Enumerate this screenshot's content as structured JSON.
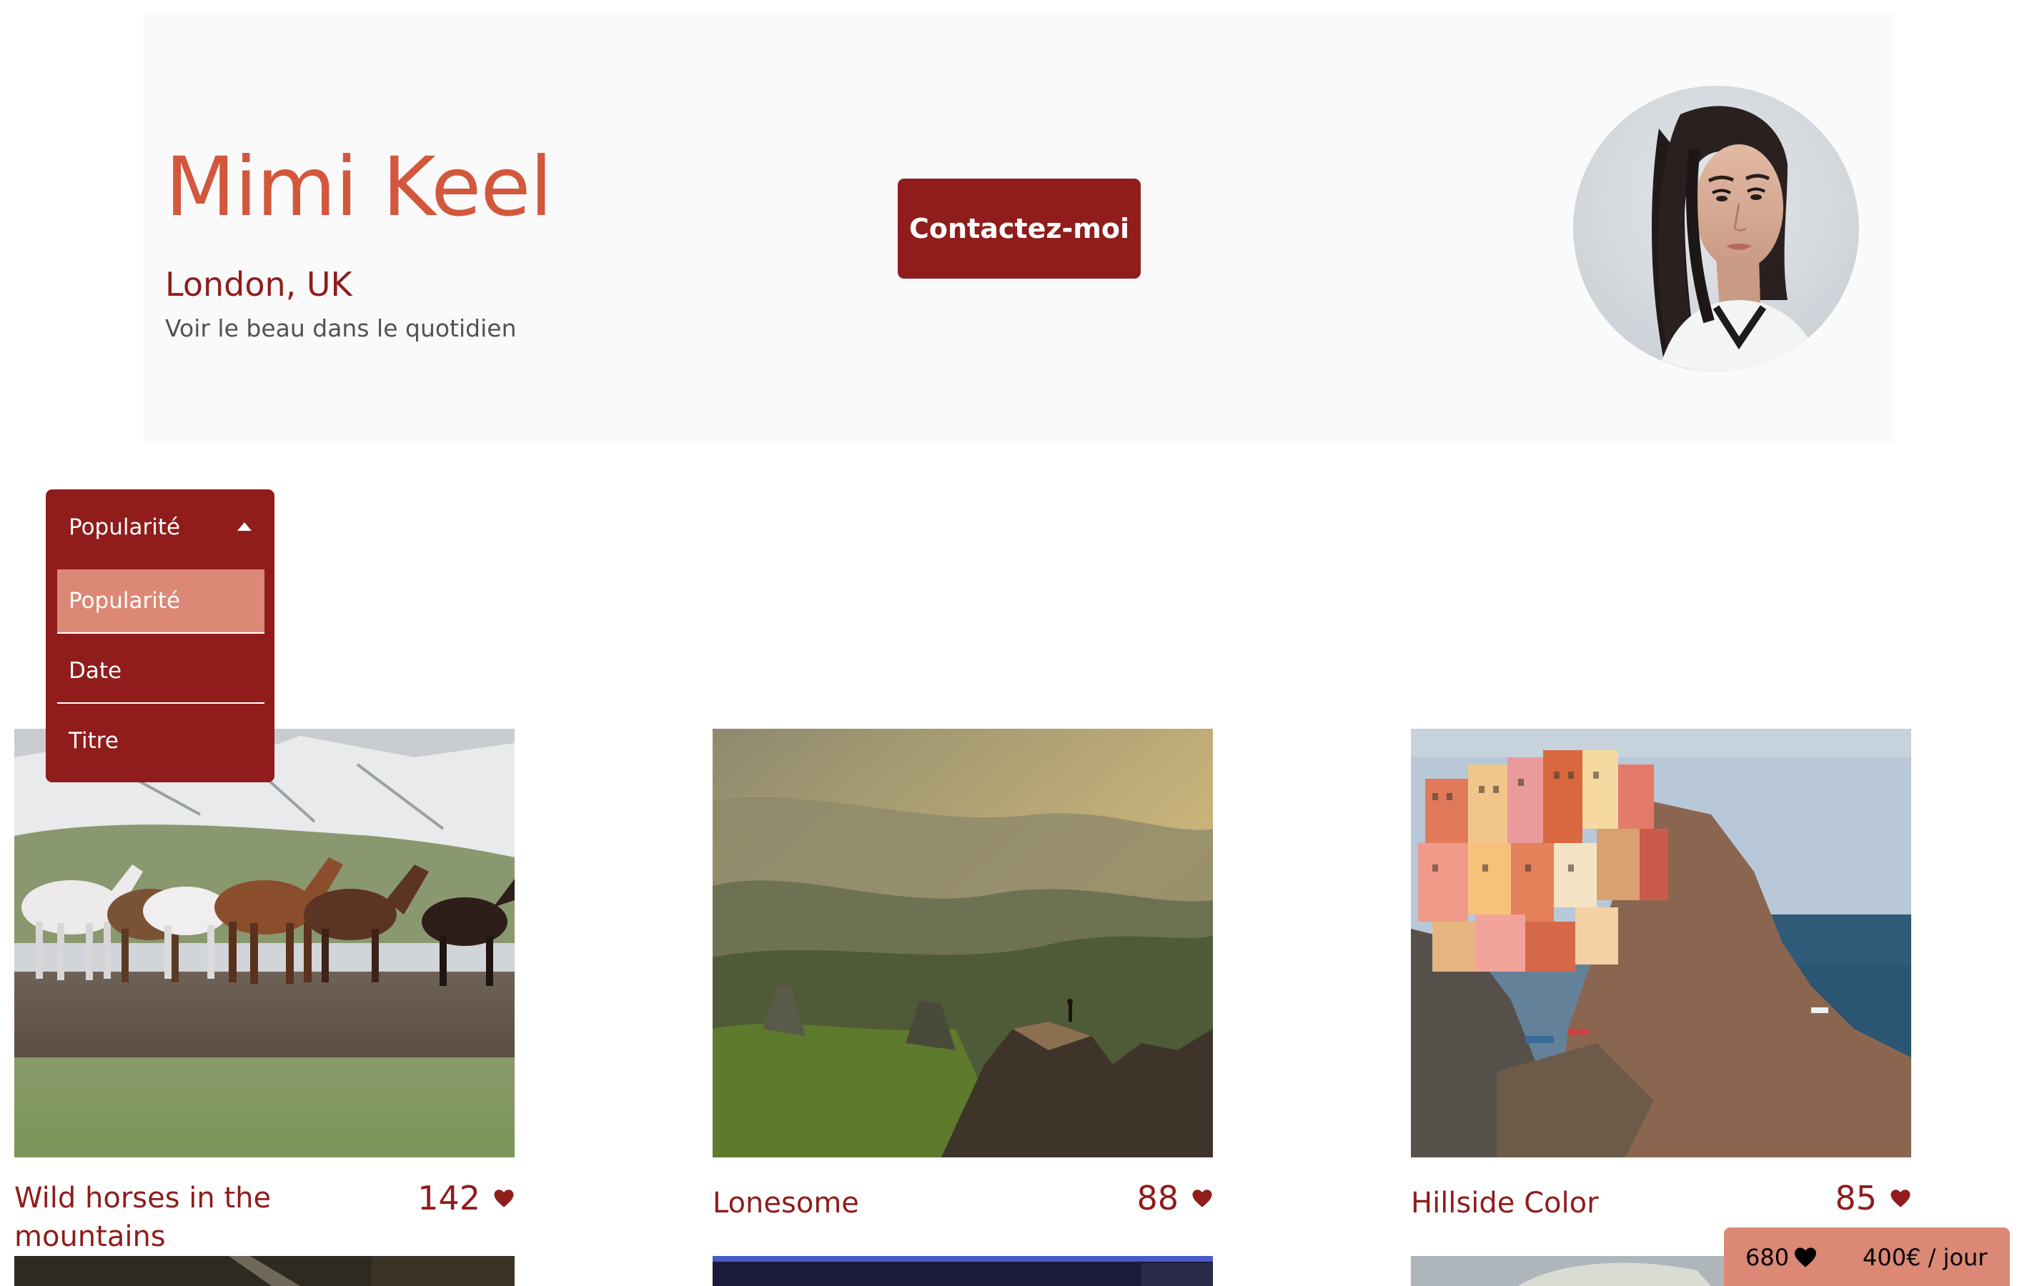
{
  "header": {
    "name": "Mimi Keel",
    "location": "London, UK",
    "tagline": "Voir le beau dans le quotidien",
    "contact_label": "Contactez-moi"
  },
  "sort": {
    "selected": "Popularité",
    "options": [
      "Popularité",
      "Date",
      "Titre"
    ],
    "active_index": 0
  },
  "media": [
    {
      "title": "Wild horses in the mountains",
      "likes": "142"
    },
    {
      "title": "Lonesome",
      "likes": "88"
    },
    {
      "title": "Hillside Color",
      "likes": "85"
    }
  ],
  "stats": {
    "total_likes": "680",
    "price": "400€ / jour"
  },
  "colors": {
    "primary": "#901c1c",
    "accent": "#d3573c",
    "secondary": "#db8876",
    "header_bg": "#fafafa"
  },
  "icons": {
    "sort_toggle": "chevron-up-icon",
    "like": "heart-icon"
  }
}
